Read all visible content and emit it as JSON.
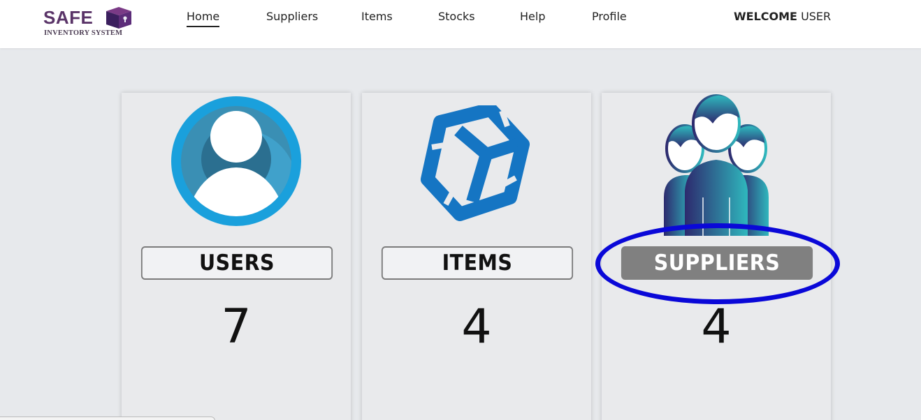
{
  "logo": {
    "title": "SAFE",
    "subtitle": "Inventory System"
  },
  "nav": {
    "items": [
      {
        "label": "Home",
        "active": true
      },
      {
        "label": "Suppliers"
      },
      {
        "label": "Items"
      },
      {
        "label": "Stocks"
      },
      {
        "label": "Help"
      },
      {
        "label": "Profile"
      }
    ],
    "welcome_bold": "WELCOME",
    "welcome_user": "USER"
  },
  "cards": [
    {
      "label": "USERS",
      "count": "7",
      "icon": "user-icon"
    },
    {
      "label": "ITEMS",
      "count": "4",
      "icon": "cube-icon"
    },
    {
      "label": "SUPPLIERS",
      "count": "4",
      "icon": "people-group-icon"
    }
  ],
  "colors": {
    "highlight": "#0a08d8",
    "logo": "#5a3468",
    "user_icon": "#1a9ad9",
    "cube_icon": "#1575c3",
    "people_teal": "#2fb7bd",
    "people_navy": "#2d2a6e"
  }
}
